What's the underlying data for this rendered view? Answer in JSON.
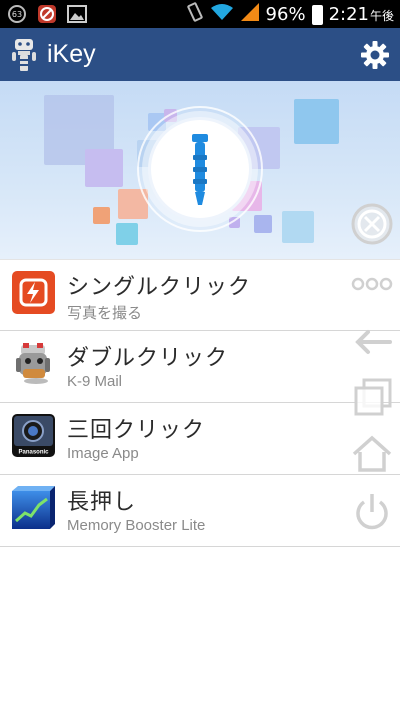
{
  "status_bar": {
    "notification_badge": "63",
    "battery_percent": "96%",
    "time": "2:21",
    "time_suffix": "午後",
    "icons": [
      "notification-count-icon",
      "blocked-app-icon",
      "gallery-icon",
      "vibrate-icon",
      "wifi-icon",
      "signal-icon",
      "battery-icon"
    ]
  },
  "app_bar": {
    "title": "iKey",
    "logo_icon": "ikey-robot-icon",
    "settings_icon": "gear-icon"
  },
  "banner": {
    "center_icon": "earphone-jack-key-icon",
    "accent_color": "#1f8be0"
  },
  "actions": [
    {
      "title": "シングルクリック",
      "subtitle": "写真を撮る",
      "icon": "flash-camera-app-icon"
    },
    {
      "title": "ダブルクリック",
      "subtitle": "K-9 Mail",
      "icon": "k9-mail-dog-icon"
    },
    {
      "title": "三回クリック",
      "subtitle": "Image App",
      "icon": "panasonic-image-app-icon"
    },
    {
      "title": "長押し",
      "subtitle": "Memory Booster Lite",
      "icon": "memory-booster-chart-icon"
    }
  ],
  "floating_nav": {
    "buttons": [
      "close-circle-icon",
      "more-dots-icon",
      "back-arrow-icon",
      "recent-apps-icon",
      "home-icon",
      "power-icon"
    ]
  }
}
